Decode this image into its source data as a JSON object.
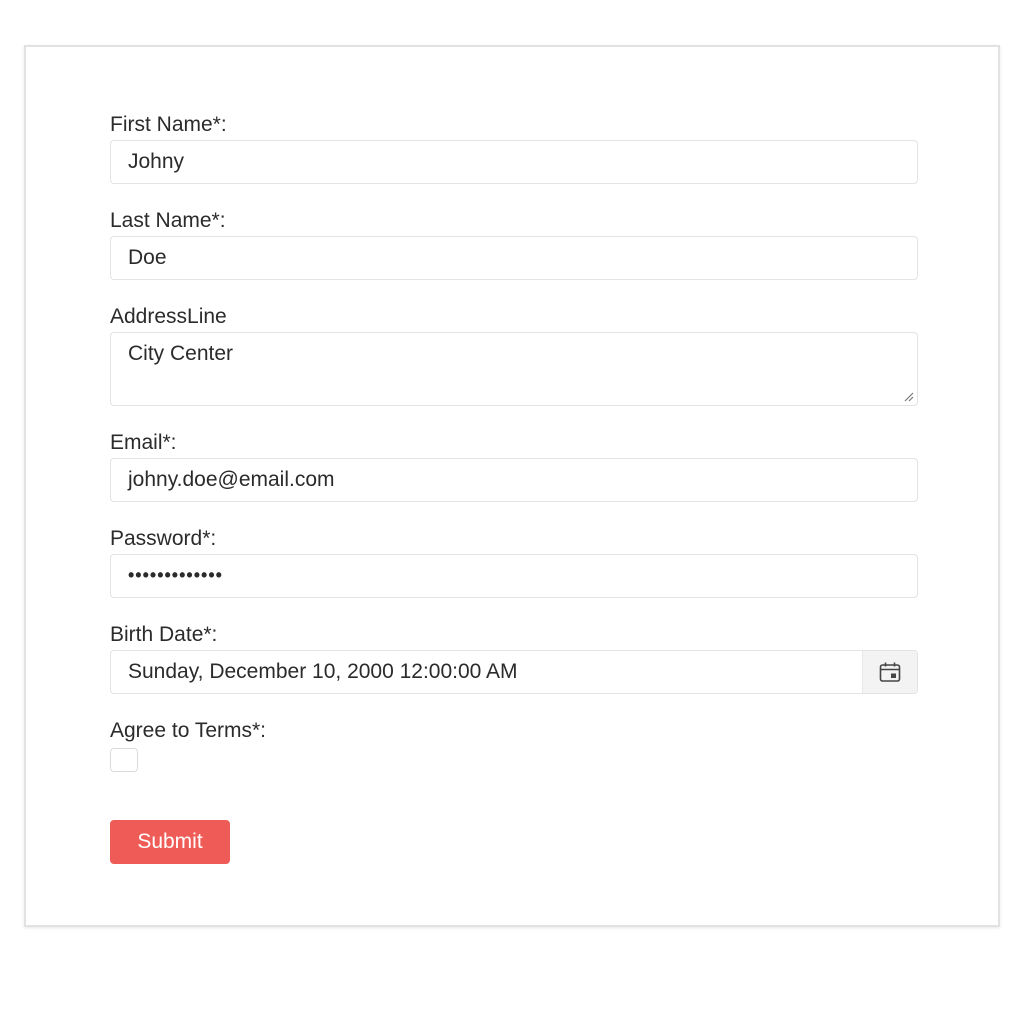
{
  "form": {
    "first_name": {
      "label": "First Name*:",
      "value": "Johny"
    },
    "last_name": {
      "label": "Last Name*:",
      "value": "Doe"
    },
    "address_line": {
      "label": "AddressLine",
      "value": "City Center"
    },
    "email": {
      "label": "Email*:",
      "value": "johny.doe@email.com"
    },
    "password": {
      "label": "Password*:",
      "value": "•••••••••••••"
    },
    "birth_date": {
      "label": "Birth Date*:",
      "value": "Sunday, December 10, 2000 12:00:00 AM"
    },
    "agree_terms": {
      "label": "Agree to Terms*:",
      "checked": false
    },
    "submit_label": "Submit"
  },
  "colors": {
    "accent": "#ef5c57",
    "border": "#e3e3e3"
  },
  "icons": {
    "calendar": "calendar-icon",
    "resize": "resize-handle-icon"
  }
}
